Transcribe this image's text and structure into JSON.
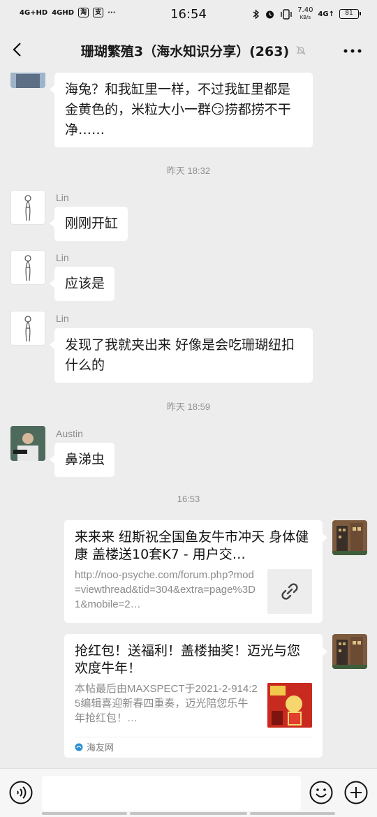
{
  "status_bar": {
    "net1": "4G+HD",
    "net2": "4GHD",
    "app_badge_1": "淘",
    "app_badge_2": "支",
    "more": "···",
    "time": "16:54",
    "speed_value": "7.40",
    "speed_unit": "KB/s",
    "net3": "4G↑",
    "battery": "81"
  },
  "header": {
    "title": "珊瑚繁殖3（海水知识分享）(263)"
  },
  "messages": {
    "m0_text": "海兔？和我缸里一样，不过我缸里都是金黄色的，米粒大小一群😏捞都捞不干净……",
    "ts1": "昨天 18:32",
    "m1_sender": "Lin",
    "m1_text": "刚刚开缸",
    "m2_sender": "Lin",
    "m2_text": "应该是",
    "m3_sender": "Lin",
    "m3_text": "发现了我就夹出来 好像是会吃珊瑚纽扣什么的",
    "ts2": "昨天 18:59",
    "m4_sender": "Austin",
    "m4_text": "鼻涕虫",
    "ts3": "16:53",
    "card1": {
      "title": "来来来 纽斯祝全国鱼友牛市冲天 身体健康 盖楼送10套K7 - 用户交…",
      "desc": "http://noo-psyche.com/forum.php?mod=viewthread&tid=304&extra=page%3D1&mobile=2…",
      "thumb_icon": "link-icon"
    },
    "card2": {
      "title": "抢红包！送福利！盖楼抽奖！迈光与您欢度牛年！",
      "desc": "本帖最后由MAXSPECT于2021-2-914:25编辑喜迎新春四重奏，迈光陪您乐牛年抢红包！…",
      "source": "海友网"
    }
  },
  "input_bar": {
    "placeholder": ""
  },
  "colors": {
    "background": "#ededed",
    "bubble": "#ffffff",
    "timestamp": "#8f8f8f"
  }
}
